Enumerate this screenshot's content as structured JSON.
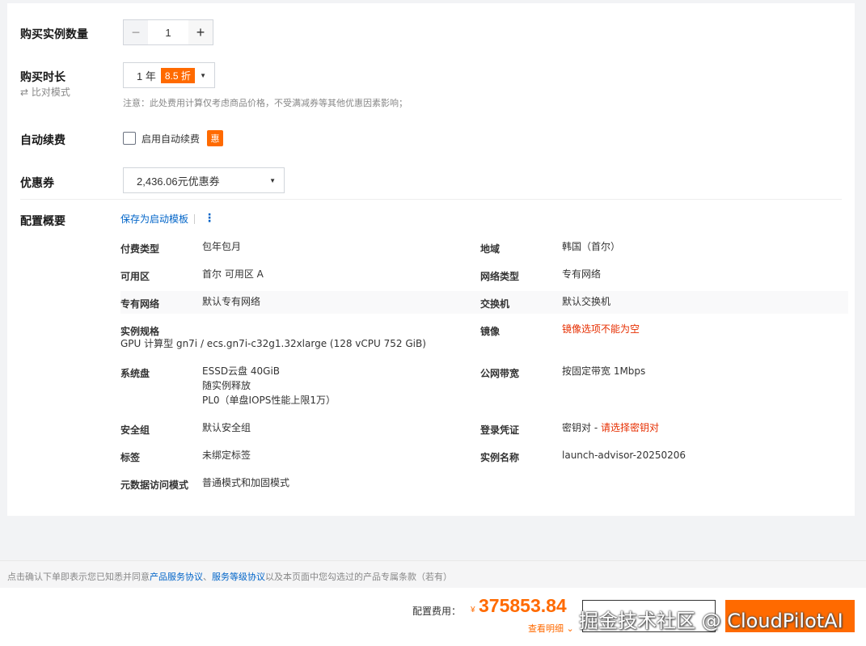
{
  "form": {
    "instance_count_label": "购买实例数量",
    "instance_count_value": "1",
    "minus": "−",
    "plus": "+",
    "duration_label": "购买时长",
    "compare_icon": "⇄",
    "compare_mode": "比对模式",
    "duration_value": "1 年",
    "duration_discount": "8.5 折",
    "duration_note": "注意：此处费用计算仅考虑商品价格，不受满减券等其他优惠因素影响；",
    "auto_renew_label": "自动续费",
    "auto_renew_checkbox": "启用自动续费",
    "auto_renew_badge": "惠",
    "coupon_label": "优惠券",
    "coupon_value": "2,436.06元优惠券",
    "caret": "▼"
  },
  "summary": {
    "title": "配置概要",
    "save_template": "保存为启动模板",
    "more_icon": "⋮",
    "items": {
      "billing_type_k": "付费类型",
      "billing_type_v": "包年包月",
      "region_k": "地域",
      "region_v": "韩国（首尔）",
      "zone_k": "可用区",
      "zone_v": "首尔 可用区 A",
      "network_type_k": "网络类型",
      "network_type_v": "专有网络",
      "vpc_k": "专有网络",
      "vpc_v": "默认专有网络",
      "vswitch_k": "交换机",
      "vswitch_v": "默认交换机",
      "spec_k": "实例规格",
      "spec_v": "GPU 计算型 gn7i / ecs.gn7i-c32g1.32xlarge (128 vCPU 752 GiB)",
      "image_k": "镜像",
      "image_v": "镜像选项不能为空",
      "disk_k": "系统盘",
      "disk_v1": "ESSD云盘 40GiB",
      "disk_v2": "随实例释放",
      "disk_v3": "PL0（单盘IOPS性能上限1万）",
      "bandwidth_k": "公网带宽",
      "bandwidth_v": "按固定带宽 1Mbps",
      "sg_k": "安全组",
      "sg_v": "默认安全组",
      "login_k": "登录凭证",
      "login_v_prefix": "密钥对 - ",
      "login_v_link": "请选择密钥对",
      "tag_k": "标签",
      "tag_v": "未绑定标签",
      "name_k": "实例名称",
      "name_v": "launch-advisor-20250206",
      "metadata_k": "元数据访问模式",
      "metadata_v": "普通模式和加固模式"
    }
  },
  "agreement": {
    "prefix": "点击确认下单即表示您已知悉并同意",
    "link1": "产品服务协议",
    "sep": "、",
    "link2": "服务等级协议",
    "suffix": "以及本页面中您勾选过的产品专属条款（若有）"
  },
  "footer": {
    "fee_label": "配置费用：",
    "currency": "¥",
    "price": "375853.84",
    "detail": "查看明细 ⌄"
  },
  "watermark": "掘金技术社区 @ CloudPilotAI"
}
